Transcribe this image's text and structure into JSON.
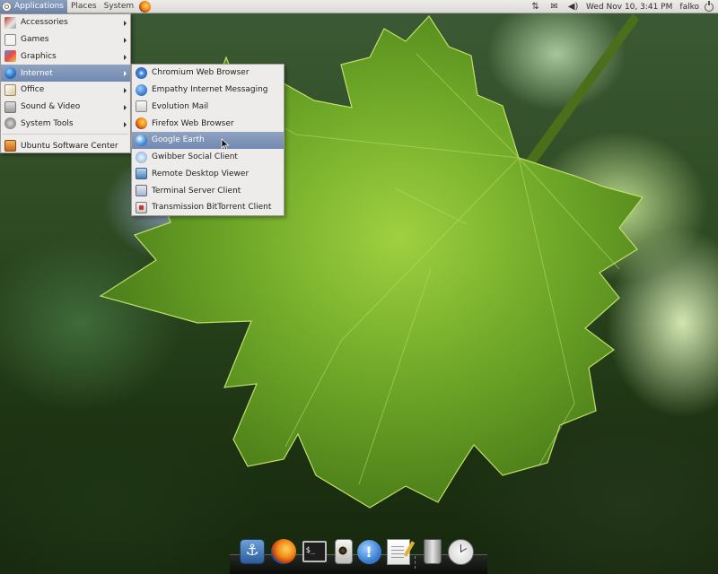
{
  "top_panel": {
    "menus": [
      "Applications",
      "Places",
      "System"
    ],
    "launchers": [
      "firefox-icon"
    ],
    "indicators": [
      "network-icon",
      "mail-icon",
      "volume-icon"
    ],
    "clock": "Wed Nov 10,  3:41 PM",
    "user": "falko",
    "session_icon": "power-icon"
  },
  "applications_menu": {
    "items": [
      {
        "label": "Accessories",
        "icon": "accessories-icon",
        "has_submenu": true
      },
      {
        "label": "Games",
        "icon": "games-icon",
        "has_submenu": true
      },
      {
        "label": "Graphics",
        "icon": "graphics-icon",
        "has_submenu": true
      },
      {
        "label": "Internet",
        "icon": "internet-globe-icon",
        "has_submenu": true,
        "selected": true
      },
      {
        "label": "Office",
        "icon": "office-icon",
        "has_submenu": true
      },
      {
        "label": "Sound & Video",
        "icon": "sound-video-icon",
        "has_submenu": true
      },
      {
        "label": "System Tools",
        "icon": "system-tools-icon",
        "has_submenu": true
      }
    ],
    "footer_item": {
      "label": "Ubuntu Software Center",
      "icon": "software-center-icon"
    }
  },
  "internet_menu": {
    "items": [
      {
        "label": "Chromium Web Browser",
        "icon": "chromium-icon"
      },
      {
        "label": "Empathy Internet Messaging",
        "icon": "empathy-icon"
      },
      {
        "label": "Evolution Mail",
        "icon": "evolution-mail-icon"
      },
      {
        "label": "Firefox Web Browser",
        "icon": "firefox-icon"
      },
      {
        "label": "Google Earth",
        "icon": "google-earth-icon",
        "selected": true
      },
      {
        "label": "Gwibber Social Client",
        "icon": "gwibber-icon"
      },
      {
        "label": "Remote Desktop Viewer",
        "icon": "remote-desktop-icon"
      },
      {
        "label": "Terminal Server Client",
        "icon": "terminal-server-icon"
      },
      {
        "label": "Transmission BitTorrent Client",
        "icon": "transmission-icon"
      }
    ]
  },
  "dock": {
    "items": [
      "anchor-icon",
      "firefox-icon",
      "terminal-icon",
      "media-player-icon",
      "notification-icon",
      "text-editor-icon",
      "trash-icon",
      "clock-icon"
    ],
    "terminal_glyph": "$_"
  },
  "colors": {
    "panel_bg": "#dcdad5",
    "menu_bg": "#edecea",
    "selection": "#7a90b5",
    "leaf_green": "#6fa828"
  }
}
